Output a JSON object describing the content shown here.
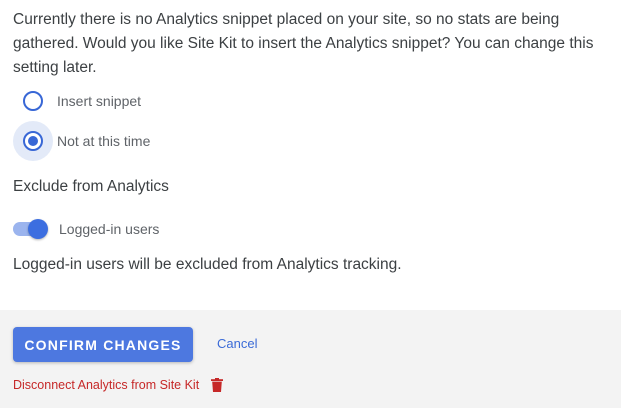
{
  "intro": {
    "text": "Currently there is no Analytics snippet placed on your site, so no stats are being gathered. Would you like Site Kit to insert the Analytics snippet? You can change this setting later."
  },
  "snippet_options": {
    "items": [
      {
        "label": "Insert snippet",
        "selected": false
      },
      {
        "label": "Not at this time",
        "selected": true
      }
    ]
  },
  "exclude": {
    "heading": "Exclude from Analytics",
    "toggle_label": "Logged-in users",
    "toggle_on": true,
    "note": "Logged-in users will be excluded from Analytics tracking."
  },
  "footer": {
    "confirm_label": "CONFIRM CHANGES",
    "cancel_label": "Cancel",
    "disconnect_label": "Disconnect Analytics from Site Kit",
    "disconnect_icon": "trash-icon"
  },
  "colors": {
    "accent": "#4d78e0",
    "danger": "#c62828",
    "footer_bg": "#f3f3f3"
  }
}
